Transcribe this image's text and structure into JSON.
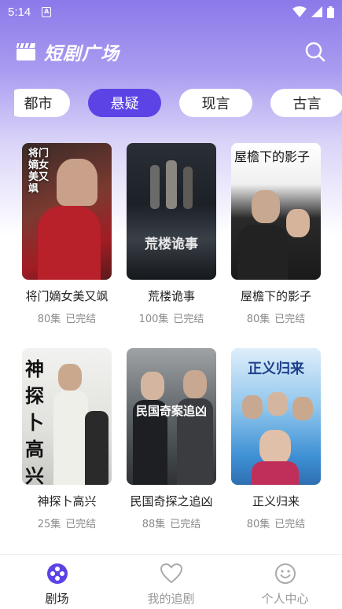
{
  "status_bar": {
    "time": "5:14",
    "notif_letter": "A"
  },
  "header": {
    "title": "短剧广场"
  },
  "tabs": [
    {
      "label": "都市",
      "active": false
    },
    {
      "label": "悬疑",
      "active": true
    },
    {
      "label": "现言",
      "active": false
    },
    {
      "label": "古言",
      "active": false
    }
  ],
  "dramas": [
    {
      "title": "将门嫡女美又飒",
      "episodes": "80集",
      "status": "已完结",
      "poster_text": "将门嫡女美又飒"
    },
    {
      "title": "荒楼诡事",
      "episodes": "100集",
      "status": "已完结",
      "poster_text": "荒楼诡事"
    },
    {
      "title": "屋檐下的影子",
      "episodes": "80集",
      "status": "已完结",
      "poster_text": "屋檐下的影子"
    },
    {
      "title": "神探卜高兴",
      "episodes": "25集",
      "status": "已完结",
      "poster_text": "神探卜高兴"
    },
    {
      "title": "民国奇探之追凶",
      "episodes": "88集",
      "status": "已完结",
      "poster_text": "民国奇案追凶"
    },
    {
      "title": "正义归来",
      "episodes": "80集",
      "status": "已完结",
      "poster_text": "正义归来"
    }
  ],
  "bottom_nav": [
    {
      "label": "剧场",
      "icon": "theater-icon",
      "active": true
    },
    {
      "label": "我的追剧",
      "icon": "heart-icon",
      "active": false
    },
    {
      "label": "个人中心",
      "icon": "smiley-icon",
      "active": false
    }
  ],
  "colors": {
    "accent": "#5b43e6",
    "header_gradient_top": "#8c79ea"
  }
}
